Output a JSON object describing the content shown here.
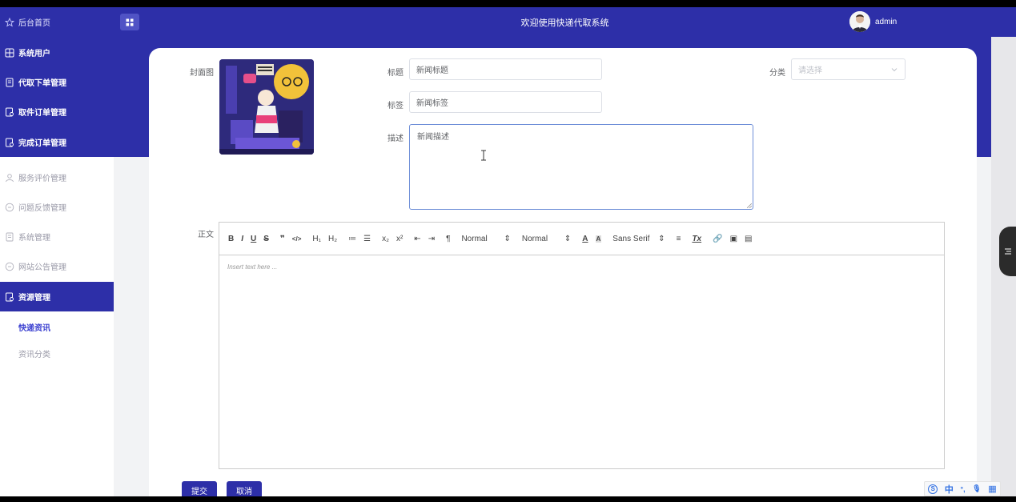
{
  "sidebar": {
    "items": [
      {
        "label": "后台首页",
        "icon": "star-icon"
      },
      {
        "label": "系统用户",
        "icon": "grid-icon"
      },
      {
        "label": "代取下单管理",
        "icon": "document-icon"
      },
      {
        "label": "取件订单管理",
        "icon": "order-icon"
      },
      {
        "label": "完成订单管理",
        "icon": "order-icon"
      },
      {
        "label": "服务评价管理",
        "icon": "user-icon"
      },
      {
        "label": "问题反馈管理",
        "icon": "chat-icon"
      },
      {
        "label": "系统管理",
        "icon": "document-icon"
      },
      {
        "label": "网站公告管理",
        "icon": "chat-icon"
      },
      {
        "label": "资源管理",
        "icon": "order-icon"
      }
    ],
    "sub_items": [
      {
        "label": "快递资讯"
      },
      {
        "label": "资讯分类"
      }
    ]
  },
  "header": {
    "title": "欢迎使用快递代取系统",
    "username": "admin"
  },
  "form": {
    "cover_label": "封面图",
    "title_label": "标题",
    "title_value": "新闻标题",
    "tag_label": "标签",
    "tag_value": "新闻标签",
    "desc_label": "描述",
    "desc_value": "新闻描述",
    "category_label": "分类",
    "category_placeholder": "请选择",
    "body_label": "正文"
  },
  "editor": {
    "toolbar": {
      "bold": "B",
      "italic": "I",
      "underline": "U",
      "strike": "S",
      "quote": "❞",
      "code": "</>",
      "h1": "H₁",
      "h2": "H₂",
      "ordered_list": "≔",
      "bullet_list": "☰",
      "subscript": "x₂",
      "superscript": "x²",
      "outdent": "⇤",
      "indent": "⇥",
      "direction": "¶",
      "size_select": "Normal",
      "header_select": "Normal",
      "font_color": "A",
      "bg_color": "A",
      "font_select": "Sans Serif",
      "align": "≡",
      "clean": "Tx",
      "link": "🔗",
      "image": "▣",
      "video": "▤"
    },
    "placeholder": "Insert text here ..."
  },
  "actions": {
    "submit": "提交",
    "cancel": "取消"
  },
  "ime": {
    "logo": "S",
    "lang": "中",
    "punct": "°,",
    "voice": "🎙",
    "grid": "▦"
  },
  "colors": {
    "primary": "#2d2fa8",
    "accent": "#3a3fd0"
  }
}
